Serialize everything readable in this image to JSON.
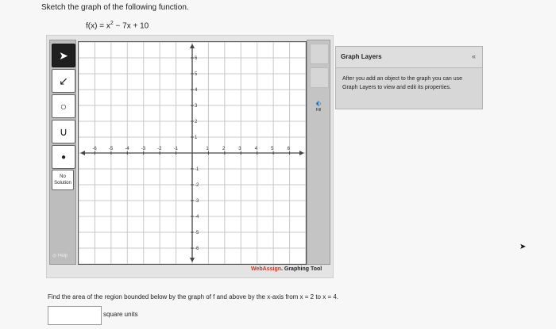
{
  "question": {
    "prompt": "Sketch the graph of the following function.",
    "function_lhs": "f(x) = x",
    "function_exp": "2",
    "function_rhs": " − 7x + 10",
    "area_question": "Find the area of the region bounded below by the graph of f and above by the x-axis from x = 2 to x = 4.",
    "answer_value": "",
    "units": "square units"
  },
  "toolbar": {
    "tools": [
      {
        "name": "pointer-icon",
        "glyph": "➤"
      },
      {
        "name": "line-icon",
        "glyph": "↙"
      },
      {
        "name": "circle-icon",
        "glyph": "○"
      },
      {
        "name": "parabola-icon",
        "glyph": "∪"
      },
      {
        "name": "point-icon",
        "glyph": "●"
      }
    ],
    "no_solution_label": "No Solution",
    "help_label": "Help"
  },
  "graph": {
    "x_ticks": [
      "-6",
      "-5",
      "-4",
      "-3",
      "-2",
      "-1",
      "1",
      "2",
      "3",
      "4",
      "5",
      "6"
    ],
    "y_ticks": [
      "6",
      "5",
      "4",
      "3",
      "2",
      "1",
      "-1",
      "-2",
      "-3",
      "-4",
      "-5",
      "-6"
    ],
    "fill_label": "Fill"
  },
  "brand": {
    "web": "Web",
    "assign": "Assign",
    "suffix": ". Graphing Tool"
  },
  "layers": {
    "title": "Graph Layers",
    "collapse": "«",
    "body": "After you add an object to the graph you can use Graph Layers to view and edit its properties."
  }
}
